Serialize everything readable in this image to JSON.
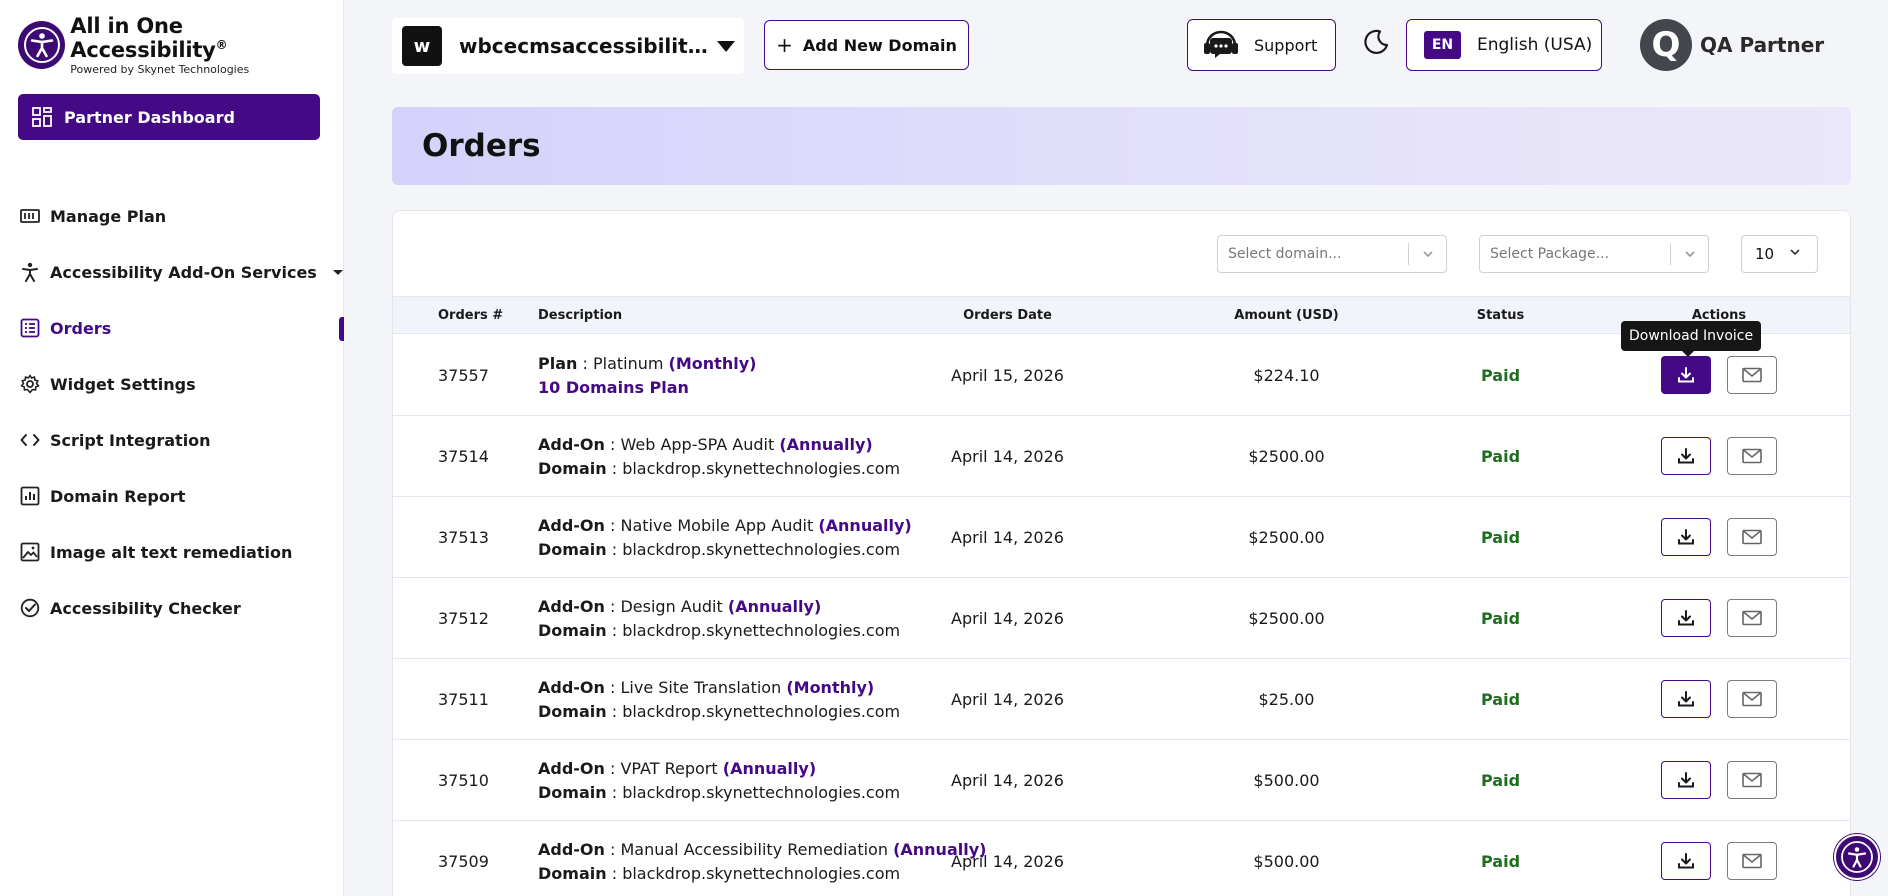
{
  "brand": {
    "title": "All in One Accessibility",
    "reg": "®",
    "subtitle": "Powered by Skynet Technologies"
  },
  "sidebar": {
    "dashboard_label": "Partner Dashboard",
    "items": [
      {
        "label": "Manage Plan"
      },
      {
        "label": "Accessibility Add-On Services"
      },
      {
        "label": "Orders"
      },
      {
        "label": "Widget Settings"
      },
      {
        "label": "Script Integration"
      },
      {
        "label": "Domain Report"
      },
      {
        "label": "Image alt text remediation"
      },
      {
        "label": "Accessibility Checker"
      }
    ]
  },
  "topbar": {
    "domain_initial": "w",
    "domain_name": "wbcecmsaccessibility.skynettechnologies.us",
    "add_domain_label": "Add New Domain",
    "support_label": "Support",
    "lang_code": "EN",
    "lang_label": "English (USA)",
    "user_initial": "Q",
    "user_name": "QA Partner"
  },
  "page": {
    "title": "Orders"
  },
  "filters": {
    "domain_placeholder": "Select domain...",
    "package_placeholder": "Select Package...",
    "per_page": "10"
  },
  "table": {
    "columns": [
      "Orders #",
      "Description",
      "Orders Date",
      "Amount (USD)",
      "Status",
      "Actions"
    ],
    "tooltip": "Download Invoice",
    "rows": [
      {
        "id": "37557",
        "kind": "Plan",
        "sep": " : ",
        "name": "Platinum",
        "cycle": "(Monthly)",
        "line2_label": "",
        "line2_value": "10 Domains Plan",
        "date": "April 15, 2026",
        "amount": "$224.10",
        "status": "Paid"
      },
      {
        "id": "37514",
        "kind": "Add-On",
        "sep": " : ",
        "name": "Web App-SPA Audit",
        "cycle": "(Annually)",
        "line2_label": "Domain",
        "line2_value": " : blackdrop.skynettechnologies.com",
        "date": "April 14, 2026",
        "amount": "$2500.00",
        "status": "Paid"
      },
      {
        "id": "37513",
        "kind": "Add-On",
        "sep": " : ",
        "name": "Native Mobile App Audit",
        "cycle": "(Annually)",
        "line2_label": "Domain",
        "line2_value": " : blackdrop.skynettechnologies.com",
        "date": "April 14, 2026",
        "amount": "$2500.00",
        "status": "Paid"
      },
      {
        "id": "37512",
        "kind": "Add-On",
        "sep": " : ",
        "name": "Design Audit",
        "cycle": "(Annually)",
        "line2_label": "Domain",
        "line2_value": " : blackdrop.skynettechnologies.com",
        "date": "April 14, 2026",
        "amount": "$2500.00",
        "status": "Paid"
      },
      {
        "id": "37511",
        "kind": "Add-On",
        "sep": " : ",
        "name": "Live Site Translation",
        "cycle": "(Monthly)",
        "line2_label": "Domain",
        "line2_value": " : blackdrop.skynettechnologies.com",
        "date": "April 14, 2026",
        "amount": "$25.00",
        "status": "Paid"
      },
      {
        "id": "37510",
        "kind": "Add-On",
        "sep": " : ",
        "name": "VPAT Report",
        "cycle": "(Annually)",
        "line2_label": "Domain",
        "line2_value": " : blackdrop.skynettechnologies.com",
        "date": "April 14, 2026",
        "amount": "$500.00",
        "status": "Paid"
      },
      {
        "id": "37509",
        "kind": "Add-On",
        "sep": " : ",
        "name": "Manual Accessibility Remediation",
        "cycle": "(Annually)",
        "line2_label": "Domain",
        "line2_value": " : blackdrop.skynettechnologies.com",
        "date": "April 14, 2026",
        "amount": "$500.00",
        "status": "Paid"
      }
    ]
  },
  "colors": {
    "accent": "#440a85",
    "paid": "#1f6d1f",
    "title_band": "#dcdafb"
  }
}
